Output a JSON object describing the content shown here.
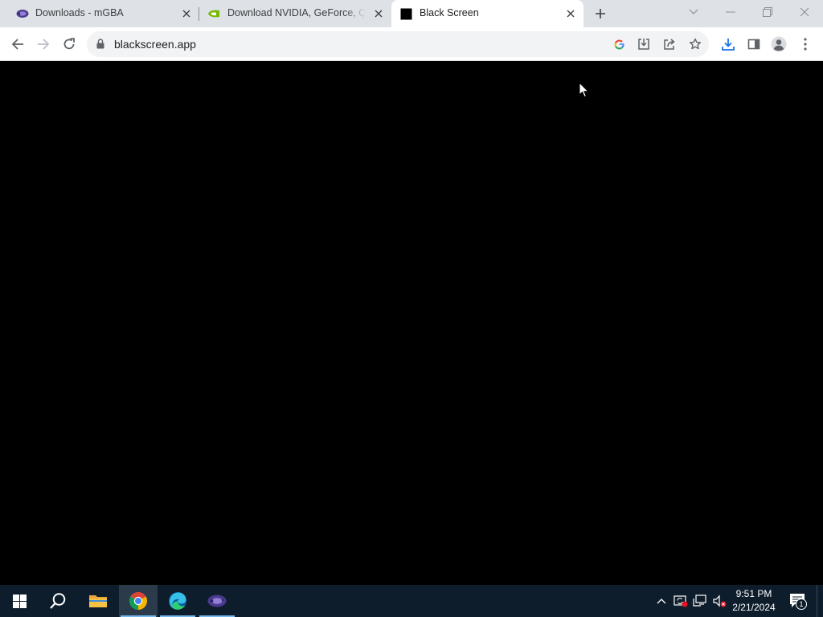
{
  "tabs": [
    {
      "title": "Downloads - mGBA",
      "favicon": "mgba-icon"
    },
    {
      "title": "Download NVIDIA, GeForce, Quadro",
      "favicon": "nvidia-icon"
    },
    {
      "title": "Black Screen",
      "favicon": "black-square-icon",
      "active": true
    }
  ],
  "toolbar": {
    "url": "blackscreen.app"
  },
  "taskbar": {
    "apps": [
      "start-icon",
      "search-icon",
      "file-explorer-icon",
      "chrome-icon",
      "edge-icon",
      "mgba-icon"
    ],
    "time": "9:51 PM",
    "date": "2/21/2024",
    "notification_count": "1"
  },
  "colors": {
    "tabstrip": "#dee1e6",
    "page_background": "#000000",
    "taskbar": "#0e1d2c",
    "accent": "#1a73e8"
  }
}
